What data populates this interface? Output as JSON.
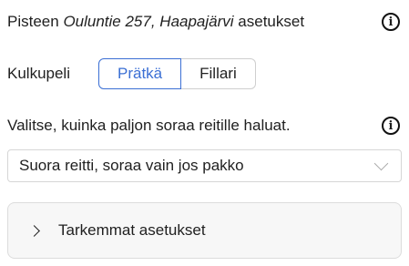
{
  "header": {
    "prefix": "Pisteen",
    "place": "Ouluntie 257, Haapajärvi",
    "suffix": "asetukset",
    "info_icon": "info-icon"
  },
  "vehicle": {
    "label": "Kulkupeli",
    "options": [
      "Prätkä",
      "Fillari"
    ],
    "selected": "Prätkä"
  },
  "gravel": {
    "label": "Valitse, kuinka paljon soraa reitille haluat.",
    "info_icon": "info-icon",
    "selected_value": "Suora reitti, soraa vain jos pakko"
  },
  "advanced": {
    "label": "Tarkemmat asetukset",
    "icon": "chevron-right-icon"
  },
  "colors": {
    "accent": "#3b6fd4",
    "panel_bg": "#f7f7f7",
    "border": "#d6d6d6"
  }
}
